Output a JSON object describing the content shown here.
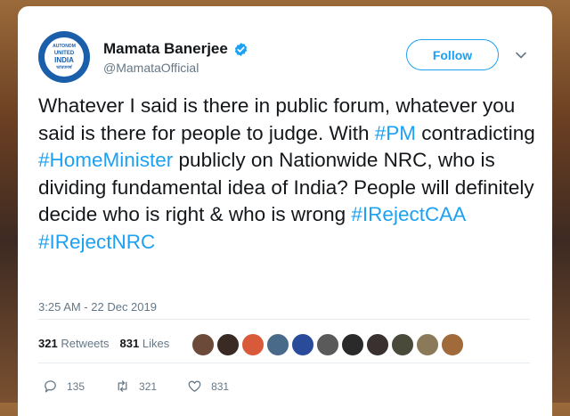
{
  "user": {
    "name": "Mamata Banerjee",
    "handle": "@MamataOfficial",
    "avatar_text_top": "AUTONOM",
    "avatar_text_mid": "UNITED",
    "avatar_text_main": "INDIA",
    "avatar_text_bottom": "ভারতবর্ষ"
  },
  "follow_label": "Follow",
  "tweet": {
    "part1": "Whatever I said is there in public forum, whatever you said is there for people to judge. With ",
    "tag1": "#PM",
    "part2": " contradicting ",
    "tag2": "#HomeMinister",
    "part3": " publicly on Nationwide NRC, who is dividing fundamental idea of India? People will definitely decide who is right & who is wrong ",
    "tag3": "#IRejectCAA",
    "part4": " ",
    "tag4": "#IRejectNRC"
  },
  "timestamp": "3:25 AM - 22 Dec 2019",
  "stats": {
    "retweets_count": "321",
    "retweets_label": "Retweets",
    "likes_count": "831",
    "likes_label": "Likes"
  },
  "likers": [
    "#6b4a3a",
    "#3a2a24",
    "#d95a3a",
    "#4a6a8a",
    "#2a4a9a",
    "#5a5a5a",
    "#2a2a2a",
    "#3a3030",
    "#4a4a3a",
    "#8a7a5a",
    "#a06a3a"
  ],
  "actions": {
    "reply_count": "135",
    "retweet_count": "321",
    "like_count": "831"
  },
  "colors": {
    "accent": "#1da1f2",
    "text": "#14171a",
    "muted": "#657786"
  }
}
